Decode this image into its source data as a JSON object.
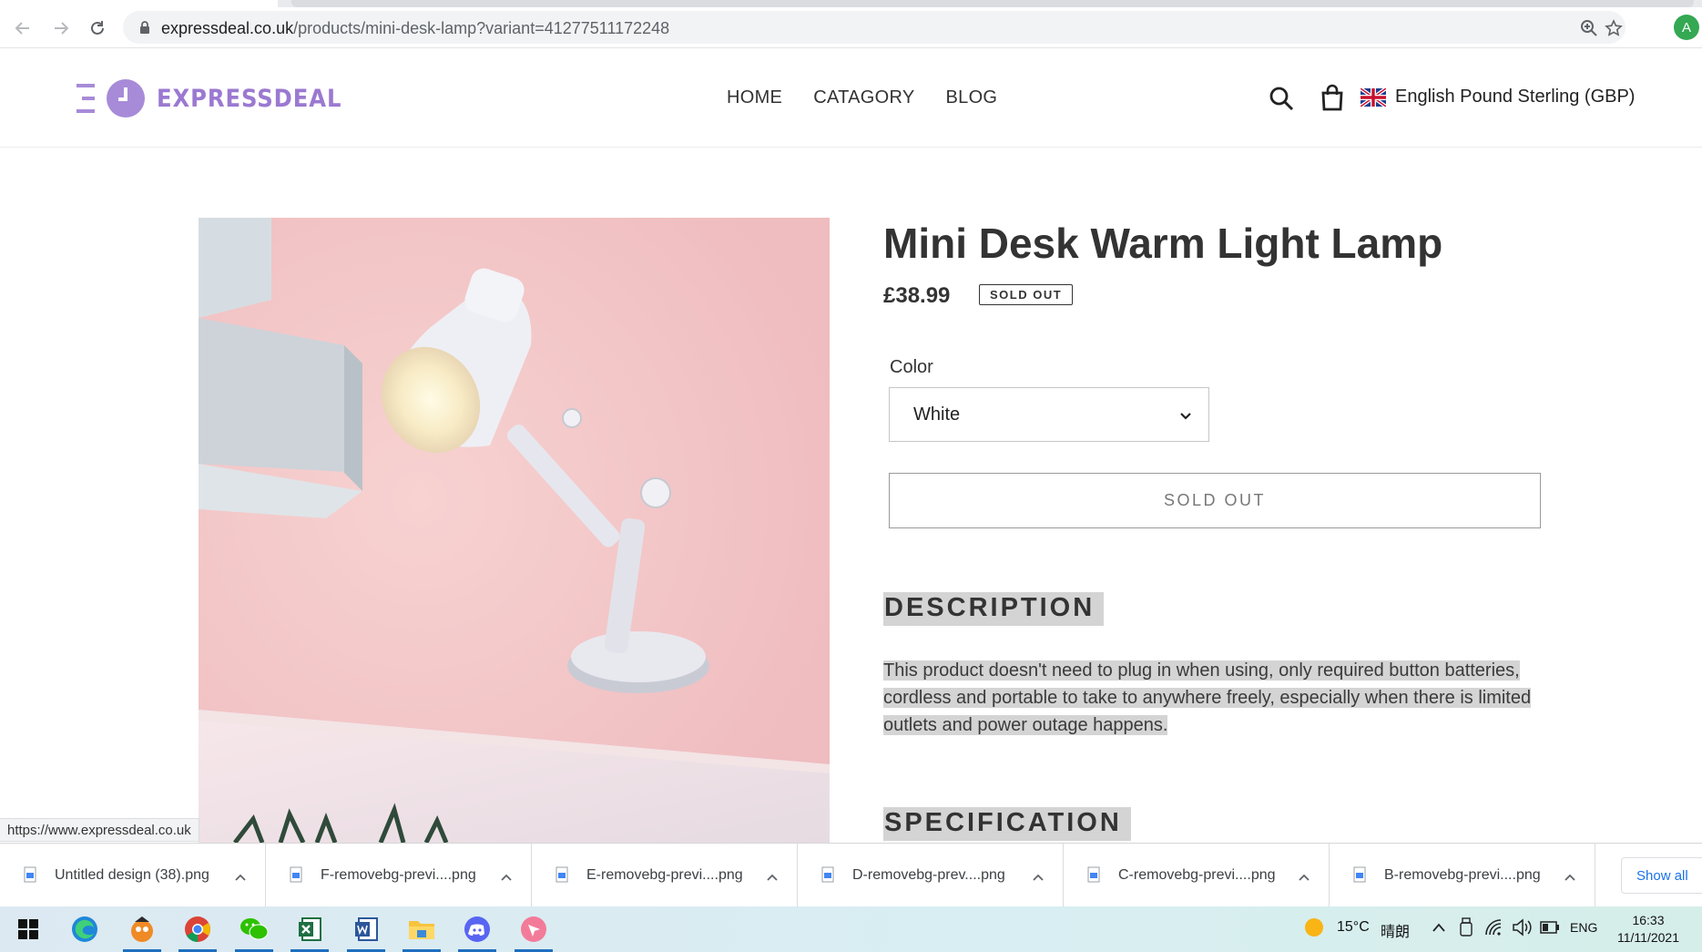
{
  "browser": {
    "url_host": "expressdeal.co.uk",
    "url_path": "/products/mini-desk-lamp?variant=41277511172248",
    "profile_initial": "A",
    "status_url": "https://www.expressdeal.co.uk"
  },
  "header": {
    "logo_text": "EXPRESSDEAL",
    "nav": [
      "HOME",
      "CATAGORY",
      "BLOG"
    ],
    "currency": "English Pound Sterling (GBP)"
  },
  "product": {
    "title": "Mini Desk Warm Light Lamp",
    "price": "£38.99",
    "badge": "SOLD OUT",
    "color_label": "Color",
    "color_value": "White",
    "button_label": "SOLD OUT",
    "description_heading": "DESCRIPTION",
    "description_text": "This product doesn't need to plug in when using, only required button batteries, cordless and portable to take to anywhere freely, especially when there is limited outlets and power outage happens.",
    "specification_heading": "SPECIFICATION"
  },
  "downloads": {
    "items": [
      "Untitled design (38).png",
      "F-removebg-previ....png",
      "E-removebg-previ....png",
      "D-removebg-prev....png",
      "C-removebg-previ....png",
      "B-removebg-previ....png"
    ],
    "show_all": "Show all"
  },
  "taskbar": {
    "weather_temp": "15°C",
    "weather_desc": "晴朗",
    "lang": "ENG",
    "time": "16:33",
    "date": "11/11/2021"
  },
  "colors": {
    "brand": "#9b79d1",
    "highlight": "#d4d4d4",
    "image_bg": "#f2c2c4"
  }
}
